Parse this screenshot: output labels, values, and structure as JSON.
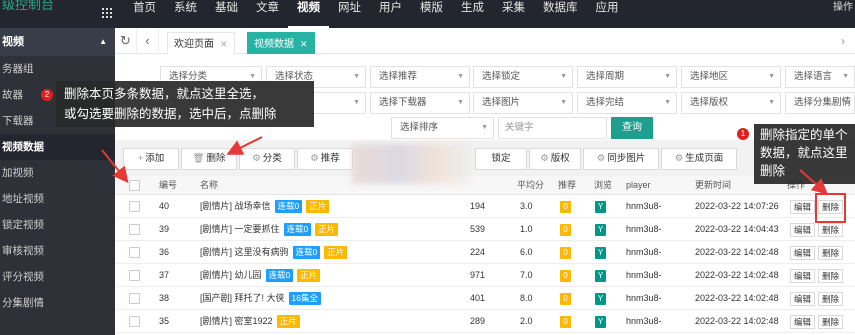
{
  "app": {
    "brand": "级控制台",
    "top_right": "操作"
  },
  "nav": [
    "首页",
    "系统",
    "基础",
    "文章",
    "视频",
    "网址",
    "用户",
    "模版",
    "生成",
    "采集",
    "数据库",
    "应用"
  ],
  "sidebar": {
    "header": "视频",
    "items": [
      "务器组",
      "故器",
      "下载器",
      "视频数据",
      "加视频",
      "地址视频",
      "锁定视频",
      "审核视频",
      "评分视频",
      "分集剧情"
    ]
  },
  "tabs": {
    "home": "欢迎页面",
    "active": "视频数据"
  },
  "filters": {
    "row1": [
      "选择分类",
      "选择状态",
      "选择推荐",
      "选择锁定",
      "选择周期",
      "选择地区",
      "选择语言"
    ],
    "row2": [
      "选择下载器",
      "选择图片",
      "选择完结",
      "选择版权",
      "选择分集剧情"
    ],
    "sort": "选择排序",
    "keyword_placeholder": "关键字",
    "query": "查询"
  },
  "toolbar": {
    "add": "添加",
    "delete": "删除",
    "category": "分类",
    "recommend": "推荐",
    "lock": "锁定",
    "copyright": "版权",
    "sync_image": "同步图片",
    "generate": "生成页面"
  },
  "table": {
    "headers": [
      "编号",
      "名称",
      "平均分",
      "推荐",
      "浏览",
      "player",
      "更新时间",
      "操作"
    ],
    "edit_label": "编辑",
    "delete_label": "删除",
    "rows": [
      {
        "id": "40",
        "type": "[剧情片]",
        "name": "战场幸信",
        "badge1": "连载0",
        "badge2": "正片",
        "hits": "194",
        "score": "3.0",
        "rec": "0",
        "view": "Y",
        "player": "hnm3u8-",
        "time": "2022-03-22 14:07:26"
      },
      {
        "id": "39",
        "type": "[剧情片]",
        "name": "一定要抓住",
        "badge1": "连载0",
        "badge2": "正片",
        "hits": "539",
        "score": "1.0",
        "rec": "0",
        "view": "Y",
        "player": "hnm3u8-",
        "time": "2022-03-22 14:04:43"
      },
      {
        "id": "36",
        "type": "[剧情片]",
        "name": "这里没有病驹",
        "badge1": "连载0",
        "badge2": "正片",
        "hits": "224",
        "score": "6.0",
        "rec": "0",
        "view": "Y",
        "player": "hnm3u8-",
        "time": "2022-03-22 14:02:48"
      },
      {
        "id": "37",
        "type": "[剧情片]",
        "name": "幼儿园",
        "badge1": "连载0",
        "badge2": "正片",
        "hits": "971",
        "score": "7.0",
        "rec": "0",
        "view": "Y",
        "player": "hnm3u8-",
        "time": "2022-03-22 14:02:48"
      },
      {
        "id": "38",
        "type": "[国产剧]",
        "name": "拜托了! 大侠",
        "badge1": "16集全",
        "badge2": "",
        "hits": "401",
        "score": "8.0",
        "rec": "0",
        "view": "Y",
        "player": "hnm3u8-",
        "time": "2022-03-22 14:02:48"
      },
      {
        "id": "35",
        "type": "[剧情片]",
        "name": "密室1922",
        "badge1": "正片",
        "badge2": "",
        "hits": "289",
        "score": "2.0",
        "rec": "0",
        "view": "Y",
        "player": "hnm3u8-",
        "time": "2022-03-22 14:02:48"
      }
    ]
  },
  "annotations": {
    "note1_num": "2",
    "note1_line1": "删除本页多条数据，就点这里全选，",
    "note1_line2": "或勾选要删除的数据，选中后，点删除",
    "note2_num": "1",
    "note2_line1": "删除指定的单个",
    "note2_line2": "数据，就点这里",
    "note2_line3": "删除"
  },
  "colors": {
    "accent": "#1e9e8c",
    "topbar": "#23262e",
    "sidebar": "#2e3138",
    "annotation": "#e53935"
  }
}
